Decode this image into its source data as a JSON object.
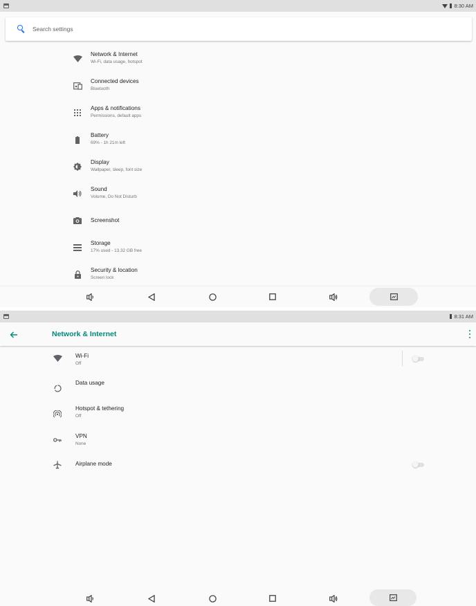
{
  "screen1": {
    "status": {
      "time": "8:30 AM"
    },
    "search": {
      "placeholder": "Search settings"
    },
    "items": [
      {
        "title": "Network & Internet",
        "subtitle": "Wi-Fi, data usage, hotspot",
        "icon": "wifi-icon"
      },
      {
        "title": "Connected devices",
        "subtitle": "Bluetooth",
        "icon": "connected-devices-icon"
      },
      {
        "title": "Apps & notifications",
        "subtitle": "Permissions, default apps",
        "icon": "apps-icon"
      },
      {
        "title": "Battery",
        "subtitle": "69% - 1h 21m left",
        "icon": "battery-icon"
      },
      {
        "title": "Display",
        "subtitle": "Wallpaper, sleep, font size",
        "icon": "display-brightness-icon"
      },
      {
        "title": "Sound",
        "subtitle": "Volume, Do Not Disturb",
        "icon": "sound-icon"
      },
      {
        "title": "Screenshot",
        "subtitle": "",
        "icon": "screenshot-camera-icon"
      },
      {
        "title": "Storage",
        "subtitle": "17% used - 13.32 GB free",
        "icon": "storage-icon"
      },
      {
        "title": "Security & location",
        "subtitle": "Screen lock",
        "icon": "lock-icon"
      }
    ]
  },
  "screen2": {
    "status": {
      "time": "8:31 AM"
    },
    "title": "Network & Internet",
    "items": [
      {
        "title": "Wi-Fi",
        "subtitle": "Off",
        "icon": "wifi-icon",
        "toggle": false
      },
      {
        "title": "Data usage",
        "subtitle": "",
        "icon": "data-usage-icon"
      },
      {
        "title": "Hotspot & tethering",
        "subtitle": "Off",
        "icon": "hotspot-icon"
      },
      {
        "title": "VPN",
        "subtitle": "None",
        "icon": "vpn-key-icon"
      },
      {
        "title": "Airplane mode",
        "subtitle": "",
        "icon": "airplane-icon",
        "toggle": false
      }
    ]
  },
  "navbar": {
    "icons": [
      "volume-down-icon",
      "back-icon",
      "home-icon",
      "recents-icon",
      "volume-up-icon",
      "screenshot-icon"
    ]
  },
  "colors": {
    "accent": "#00897b",
    "search_accent": "#1a73e8",
    "statusbar": "#e0e0e0",
    "background": "#fafafa"
  }
}
